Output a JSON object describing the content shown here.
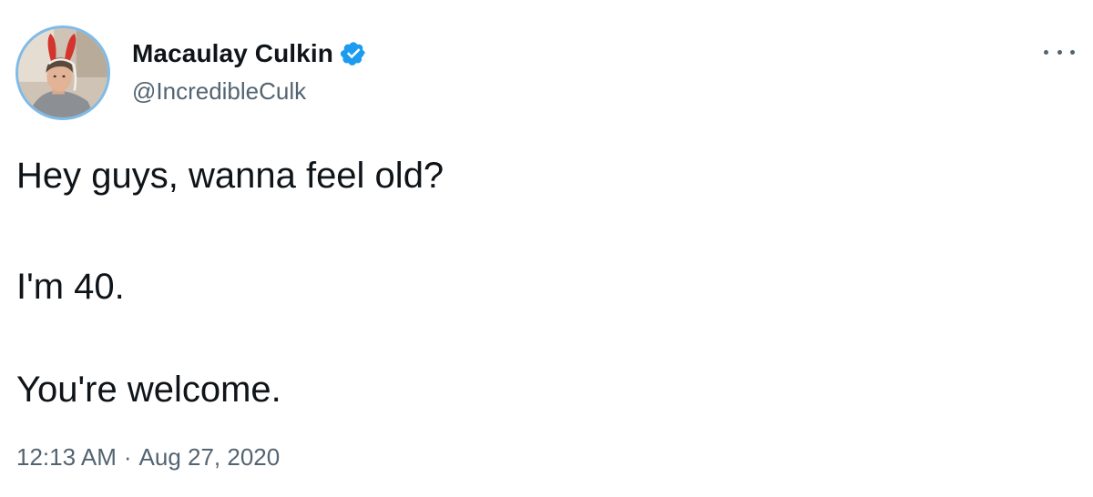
{
  "author": {
    "display_name": "Macaulay Culkin",
    "handle": "@IncredibleCulk",
    "verified": true,
    "verified_icon": "verified-badge-icon",
    "verified_color": "#1d9bf0"
  },
  "tweet": {
    "lines": [
      "Hey guys, wanna feel old?",
      "I'm 40.",
      "You're welcome."
    ]
  },
  "meta": {
    "time": "12:13 AM",
    "separator": "·",
    "date": "Aug 27, 2020"
  },
  "menu": {
    "icon": "more-options-icon"
  },
  "colors": {
    "text_primary": "#0f1419",
    "text_secondary": "#536471",
    "avatar_ring": "#7fbbe8"
  }
}
